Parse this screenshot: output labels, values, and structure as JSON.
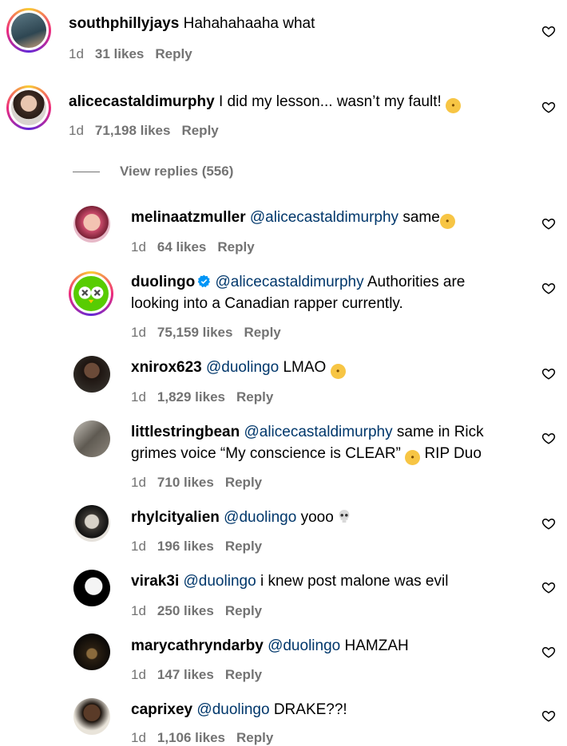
{
  "comments": [
    {
      "user": "southphillyjays",
      "text": "Hahahahaaha what",
      "time": "1d",
      "likes": "31 likes",
      "reply": "Reply"
    },
    {
      "user": "alicecastaldimurphy",
      "text": "I did my lesson... wasn’t my fault!",
      "time": "1d",
      "likes": "71,198 likes",
      "reply": "Reply"
    }
  ],
  "view_replies": "View replies (556)",
  "replies": [
    {
      "user": "melinaatzmuller",
      "mention": "@alicecastaldimurphy",
      "text": "same",
      "time": "1d",
      "likes": "64 likes",
      "reply": "Reply"
    },
    {
      "user": "duolingo",
      "mention": "@alicecastaldimurphy",
      "text": "Authorities are",
      "text2": "looking into a Canadian rapper currently.",
      "time": "1d",
      "likes": "75,159 likes",
      "reply": "Reply"
    },
    {
      "user": "xnirox623",
      "mention": "@duolingo",
      "text": "LMAO",
      "time": "1d",
      "likes": "1,829 likes",
      "reply": "Reply"
    },
    {
      "user": "littlestringbean",
      "mention": "@alicecastaldimurphy",
      "text": "same in Rick",
      "text2a": "grimes voice “My conscience is CLEAR”",
      "text2b": "RIP Duo",
      "time": "1d",
      "likes": "710 likes",
      "reply": "Reply"
    },
    {
      "user": "rhylcityalien",
      "mention": "@duolingo",
      "text": "yooo",
      "time": "1d",
      "likes": "196 likes",
      "reply": "Reply"
    },
    {
      "user": "virak3i",
      "mention": "@duolingo",
      "text": "i knew post malone was evil",
      "time": "1d",
      "likes": "250 likes",
      "reply": "Reply"
    },
    {
      "user": "marycathryndarby",
      "mention": "@duolingo",
      "text": "HAMZAH",
      "time": "1d",
      "likes": "147 likes",
      "reply": "Reply"
    },
    {
      "user": "caprixey",
      "mention": "@duolingo",
      "text": "DRAKE??!",
      "time": "1d",
      "likes": "1,106 likes",
      "reply": "Reply"
    }
  ],
  "icons": {
    "like": "heart-outline-icon",
    "verified": "verified-badge-icon"
  },
  "colors": {
    "mention": "#00376b",
    "meta": "#737373",
    "verified": "#0095f6"
  }
}
